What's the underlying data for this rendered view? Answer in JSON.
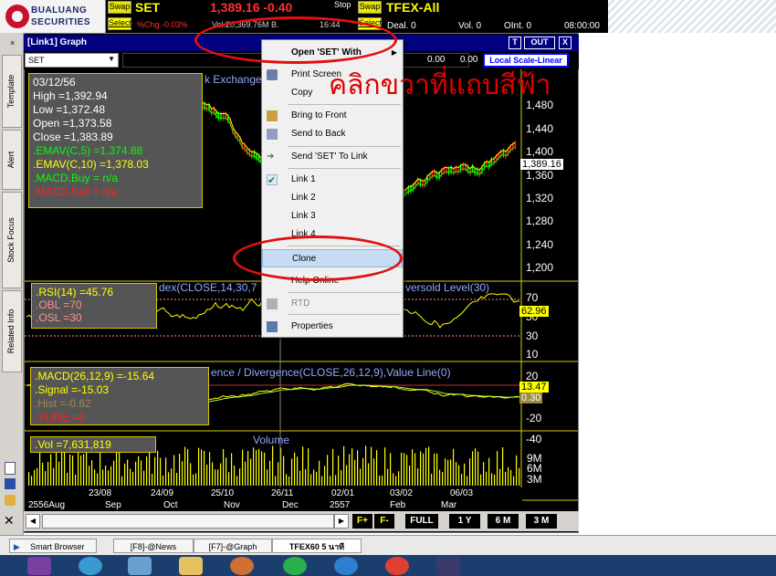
{
  "header": {
    "logo_text_1": "BUALUANG",
    "logo_text_2": "SECURITIES",
    "swap_label": "Swap",
    "select_label": "Select",
    "symbol": "SET",
    "price_change": "1,389.16 -0.40",
    "pct_change": "%Chg.-0.03%",
    "volume": "Vol.20,369.76M B.",
    "time": "16:44",
    "stop_label": "Stop",
    "tfex_label": "TFEX-All",
    "deal": "Deal. 0",
    "vol0": "Vol. 0",
    "oint": "OInt. 0",
    "clock": "08:00:00"
  },
  "left_tabs": [
    "Template",
    "Alert",
    "Stock Focus",
    "Related Info"
  ],
  "graph_window": {
    "title": "[Link1] Graph",
    "symbol_input": "SET",
    "window_buttons": [
      "T",
      "OUT",
      "X"
    ],
    "scale_label": "Local Scale-Linear",
    "toolbar_value_1": "0.00",
    "toolbar_value_2": "0.00"
  },
  "price_pane": {
    "chart_title": "k Exchange",
    "date": "03/12/56",
    "high": "High  =1,392.94",
    "low": "Low  =1,372.48",
    "open": "Open  =1,373.58",
    "close": "Close  =1,383.89",
    "ema5": ".EMAV(C,5)   =1,374.88",
    "ema10": ".EMAV(C,10)   =1,378.03",
    "macd_buy": ".MACD.Buy  = n/a",
    "macd_sell": ".MACD.Sell  = n/a",
    "axis": [
      "1,480",
      "1,440",
      "1,400",
      "1,360",
      "1,320",
      "1,280",
      "1,240",
      "1,200"
    ],
    "last_price": "1,389.16"
  },
  "rsi_pane": {
    "title": "dex(CLOSE,14,30,7",
    "title_right": "versold Level(30)",
    "rsi": ".RSI(14)   =45.76",
    "obl": ".OBL   =70",
    "osl": ".OSL   =30",
    "axis": [
      "70",
      "50",
      "30",
      "10"
    ],
    "tag": "62.96"
  },
  "macd_pane": {
    "title": "ence / Divergence(CLOSE,26,12,9),Value Line(0)",
    "macd": ".MACD(26,12,9)   =-15.64",
    "signal": ".Signal  =-15.03",
    "hist": ".Hist  =-0.62",
    "vline": ".VLINE   =0",
    "axis": [
      "20",
      "0",
      "-20",
      "-40"
    ],
    "tag1": "13.47",
    "tag2": "0.30"
  },
  "volume_pane": {
    "title": "Volume",
    "vol": ".Vol  =7,631,819",
    "axis": [
      "9M",
      "6M",
      "3M"
    ]
  },
  "x_axis": {
    "top": [
      "23/08",
      "24/09",
      "25/10",
      "26/11",
      "02/01",
      "03/02",
      "06/03"
    ],
    "bottom": [
      "2556Aug",
      "Sep",
      "Oct",
      "Nov",
      "Dec",
      "2557",
      "Feb",
      "Mar"
    ]
  },
  "bottom_buttons": [
    "F+",
    "F-",
    "FULL",
    "1 Y",
    "6 M",
    "3 M"
  ],
  "context_menu": {
    "items": [
      {
        "label": "Open 'SET' With",
        "sub": true
      },
      {
        "label": "Print Screen"
      },
      {
        "label": "Copy"
      },
      {
        "label": "Bring to Front"
      },
      {
        "label": "Send to Back"
      },
      {
        "label": "Send 'SET' To Link"
      },
      {
        "label": "Link 1"
      },
      {
        "label": "Link 2"
      },
      {
        "label": "Link 3"
      },
      {
        "label": "Link 4"
      },
      {
        "label": "Clone"
      },
      {
        "label": "Help Online"
      },
      {
        "label": "RTD"
      },
      {
        "label": "Properties"
      }
    ]
  },
  "annotation_text": "คลิกขวาที่แถบสีฟ้า",
  "status_tabs": [
    "Smart Browser",
    "[F8]-@News",
    "[F7]-@Graph",
    "TFEX60 5 นาที"
  ],
  "colors": {
    "title_blue": "#000080",
    "highlight": "#c5dcf2",
    "annotation_red": "#e00000"
  }
}
